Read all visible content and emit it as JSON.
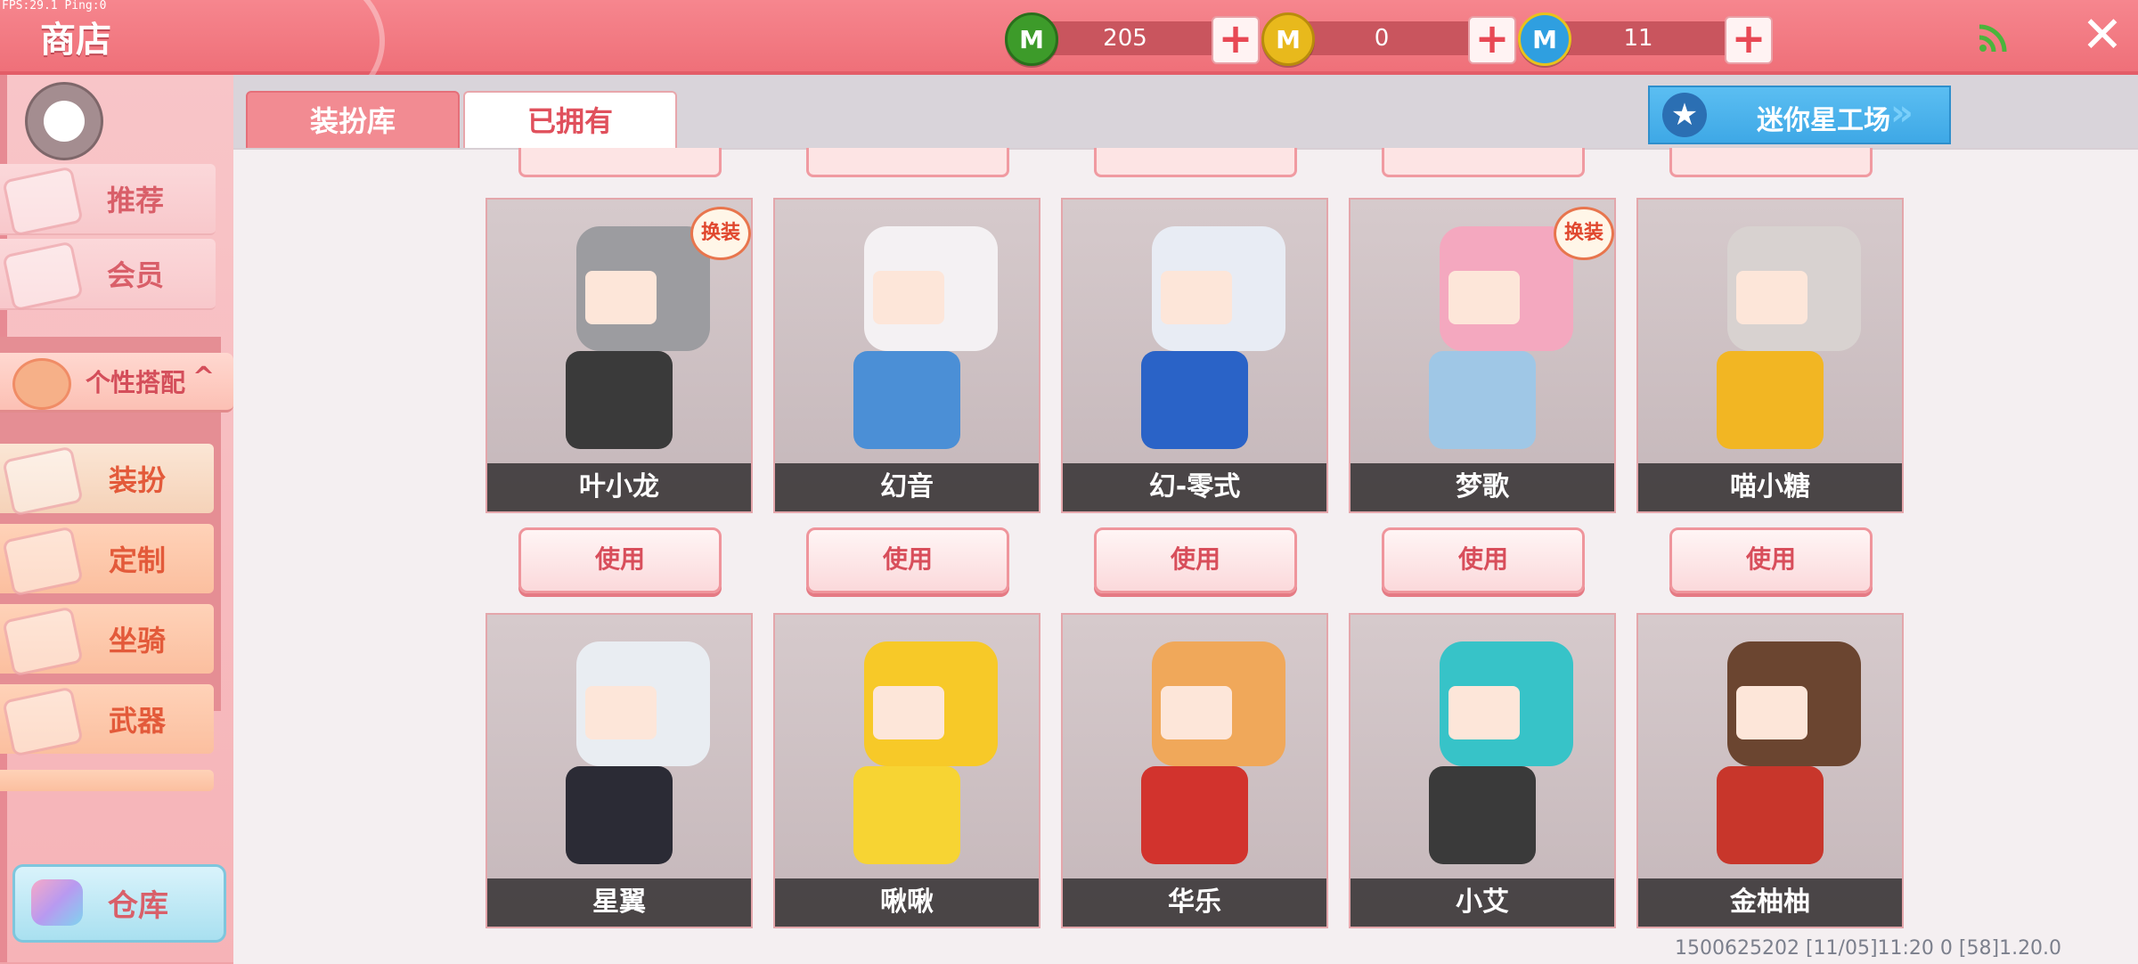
{
  "debug": {
    "fps_text": "FPS:29.1 Ping:0"
  },
  "header": {
    "title": "商店",
    "currencies": [
      {
        "name": "green-gem",
        "value": "205",
        "color": "#3d9b2a",
        "symbol": "M"
      },
      {
        "name": "gold-coin",
        "value": "0",
        "color": "#e8b91c",
        "symbol": "M"
      },
      {
        "name": "star-coin",
        "value": "11",
        "color": "#2f9fe0",
        "symbol": "M"
      }
    ],
    "plus_symbol": "+",
    "close_symbol": "✕",
    "wifi_icon": "signal-icon"
  },
  "sidebar": {
    "items": [
      {
        "label": "推荐",
        "icon": "thumbs-up-icon"
      },
      {
        "label": "会员",
        "icon": "vip-card-icon"
      }
    ],
    "group": {
      "label": "个性搭配",
      "caret": "^",
      "icon": "star-badge-icon"
    },
    "sub_items": [
      {
        "label": "装扮",
        "icon": "shirt-icon"
      },
      {
        "label": "定制",
        "icon": "pencil-ruler-icon"
      },
      {
        "label": "坐骑",
        "icon": "mount-icon"
      },
      {
        "label": "武器",
        "icon": "gun-icon"
      }
    ],
    "warehouse": {
      "label": "仓库",
      "icon": "chest-icon"
    }
  },
  "tabs": [
    {
      "label": "装扮库",
      "active": false
    },
    {
      "label": "已拥有",
      "active": true
    }
  ],
  "workshop": {
    "label": "迷你星工场",
    "icon": "star-icon"
  },
  "skins_row1": [
    {
      "name": "叶小龙",
      "badge": "换装",
      "hair": "#9c9ca0",
      "outfit": "#3a3a3a"
    },
    {
      "name": "幻音",
      "badge": "",
      "hair": "#f4f1f3",
      "outfit": "#4b8fd6"
    },
    {
      "name": "幻-零式",
      "badge": "",
      "hair": "#e8ecf4",
      "outfit": "#2a63c7"
    },
    {
      "name": "梦歌",
      "badge": "换装",
      "hair": "#f4a8bf",
      "outfit": "#9fc7e6"
    },
    {
      "name": "喵小糖",
      "badge": "",
      "hair": "#d8d2d0",
      "outfit": "#f2b623"
    }
  ],
  "skins_row2": [
    {
      "name": "星翼",
      "badge": "",
      "hair": "#e9edf2",
      "outfit": "#2b2b35"
    },
    {
      "name": "啾啾",
      "badge": "",
      "hair": "#f7c928",
      "outfit": "#f7d433"
    },
    {
      "name": "华乐",
      "badge": "",
      "hair": "#f0a85a",
      "outfit": "#d2332d"
    },
    {
      "name": "小艾",
      "badge": "",
      "hair": "#37c3c8",
      "outfit": "#3a3a3a"
    },
    {
      "name": "金柚柚",
      "badge": "",
      "hair": "#6b4530",
      "outfit": "#c8362b"
    }
  ],
  "use_label": "使用",
  "footer": {
    "text": "1500625202  [11/05]11:20 0    [58]1.20.0"
  }
}
